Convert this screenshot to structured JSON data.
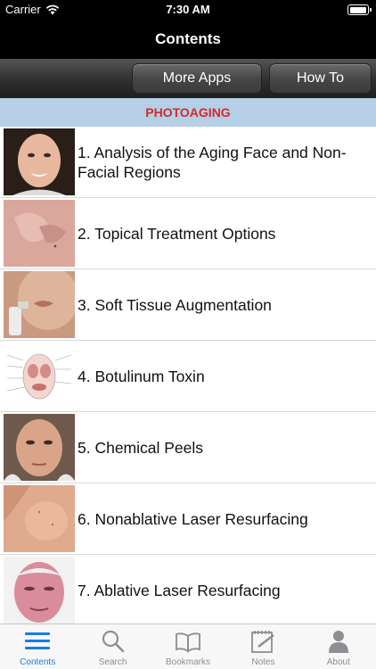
{
  "status_bar": {
    "carrier": "Carrier",
    "time": "7:30 AM",
    "battery_level": 0.95
  },
  "nav": {
    "title": "Contents"
  },
  "toolbar": {
    "more_apps": "More Apps",
    "how_to": "How To"
  },
  "section": {
    "title": "PHOTOAGING"
  },
  "items": [
    {
      "title": "1. Analysis of the Aging Face and Non-Facial Regions",
      "thumb": "face-photo-icon"
    },
    {
      "title": "2. Topical Treatment Options",
      "thumb": "skin-closeup-icon"
    },
    {
      "title": "3. Soft Tissue Augmentation",
      "thumb": "lips-injection-icon"
    },
    {
      "title": "4. Botulinum Toxin",
      "thumb": "facial-muscles-diagram-icon"
    },
    {
      "title": "5. Chemical Peels",
      "thumb": "face-photo-icon"
    },
    {
      "title": "6. Nonablative Laser Resurfacing",
      "thumb": "cheek-closeup-icon"
    },
    {
      "title": "7. Ablative Laser Resurfacing",
      "thumb": "face-photo-icon"
    }
  ],
  "tabs": [
    {
      "label": "Contents",
      "icon": "list-icon",
      "active": true
    },
    {
      "label": "Search",
      "icon": "search-icon",
      "active": false
    },
    {
      "label": "Bookmarks",
      "icon": "book-icon",
      "active": false
    },
    {
      "label": "Notes",
      "icon": "notepad-icon",
      "active": false
    },
    {
      "label": "About",
      "icon": "person-icon",
      "active": false
    }
  ],
  "colors": {
    "accent": "#1a7ce3",
    "section_text": "#d42a2a",
    "section_bg": "#b4cfe6"
  }
}
